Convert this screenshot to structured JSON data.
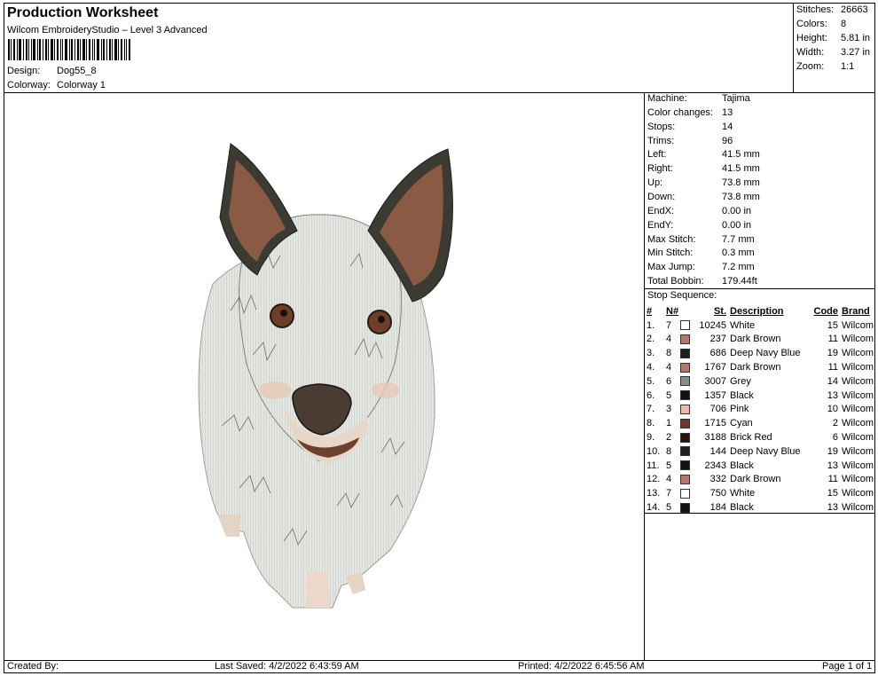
{
  "header": {
    "title": "Production Worksheet",
    "subtitle": "Wilcom EmbroideryStudio – Level 3 Advanced",
    "design_label": "Design:",
    "design_value": "Dog55_8",
    "colorway_label": "Colorway:",
    "colorway_value": "Colorway 1"
  },
  "summary": {
    "stitches_label": "Stitches:",
    "stitches": "26663",
    "colors_label": "Colors:",
    "colors": "8",
    "height_label": "Height:",
    "height": "5.81 in",
    "width_label": "Width:",
    "width": "3.27 in",
    "zoom_label": "Zoom:",
    "zoom": "1:1"
  },
  "machine_info": [
    {
      "label": "Machine:",
      "value": "Tajima"
    },
    {
      "label": "Color changes:",
      "value": "13"
    },
    {
      "label": "Stops:",
      "value": "14"
    },
    {
      "label": "Trims:",
      "value": "96"
    },
    {
      "label": "Left:",
      "value": "41.5 mm"
    },
    {
      "label": "Right:",
      "value": "41.5 mm"
    },
    {
      "label": "Up:",
      "value": "73.8 mm"
    },
    {
      "label": "Down:",
      "value": "73.8 mm"
    },
    {
      "label": "EndX:",
      "value": "0.00 in"
    },
    {
      "label": "EndY:",
      "value": "0.00 in"
    },
    {
      "label": "Max Stitch:",
      "value": "7.7 mm"
    },
    {
      "label": "Min Stitch:",
      "value": "0.3 mm"
    },
    {
      "label": "Max Jump:",
      "value": "7.2 mm"
    },
    {
      "label": "Total Bobbin:",
      "value": "179.44ft"
    }
  ],
  "stop_sequence": {
    "title": "Stop Sequence:",
    "headers": {
      "num": "#",
      "n": "N#",
      "st": "St.",
      "description": "Description",
      "code": "Code",
      "brand": "Brand"
    },
    "rows": [
      {
        "num": "1.",
        "n": "7",
        "color": "#ffffff",
        "st": "10245",
        "description": "White",
        "code": "15",
        "brand": "Wilcom"
      },
      {
        "num": "2.",
        "n": "4",
        "color": "#b5776a",
        "st": "237",
        "description": "Dark Brown",
        "code": "11",
        "brand": "Wilcom"
      },
      {
        "num": "3.",
        "n": "8",
        "color": "#1e1e1e",
        "st": "686",
        "description": "Deep Navy Blue",
        "code": "19",
        "brand": "Wilcom"
      },
      {
        "num": "4.",
        "n": "4",
        "color": "#b5776a",
        "st": "1767",
        "description": "Dark Brown",
        "code": "11",
        "brand": "Wilcom"
      },
      {
        "num": "5.",
        "n": "6",
        "color": "#8a8a8a",
        "st": "3007",
        "description": "Grey",
        "code": "14",
        "brand": "Wilcom"
      },
      {
        "num": "6.",
        "n": "5",
        "color": "#111111",
        "st": "1357",
        "description": "Black",
        "code": "13",
        "brand": "Wilcom"
      },
      {
        "num": "7.",
        "n": "3",
        "color": "#f0b8a8",
        "st": "706",
        "description": "Pink",
        "code": "10",
        "brand": "Wilcom"
      },
      {
        "num": "8.",
        "n": "1",
        "color": "#6b3a2a",
        "st": "1715",
        "description": "Cyan",
        "code": "2",
        "brand": "Wilcom"
      },
      {
        "num": "9.",
        "n": "2",
        "color": "#2a140c",
        "st": "3188",
        "description": "Brick Red",
        "code": "6",
        "brand": "Wilcom"
      },
      {
        "num": "10.",
        "n": "8",
        "color": "#1e1e1e",
        "st": "144",
        "description": "Deep Navy Blue",
        "code": "19",
        "brand": "Wilcom"
      },
      {
        "num": "11.",
        "n": "5",
        "color": "#111111",
        "st": "2343",
        "description": "Black",
        "code": "13",
        "brand": "Wilcom"
      },
      {
        "num": "12.",
        "n": "4",
        "color": "#b5776a",
        "st": "332",
        "description": "Dark Brown",
        "code": "11",
        "brand": "Wilcom"
      },
      {
        "num": "13.",
        "n": "7",
        "color": "#ffffff",
        "st": "750",
        "description": "White",
        "code": "15",
        "brand": "Wilcom"
      },
      {
        "num": "14.",
        "n": "5",
        "color": "#111111",
        "st": "184",
        "description": "Black",
        "code": "13",
        "brand": "Wilcom"
      }
    ]
  },
  "footer": {
    "created_by": "Created By:",
    "last_saved": "Last Saved: 4/2/2022 6:43:59 AM",
    "printed": "Printed: 4/2/2022 6:45:56 AM",
    "page": "Page 1 of 1"
  }
}
